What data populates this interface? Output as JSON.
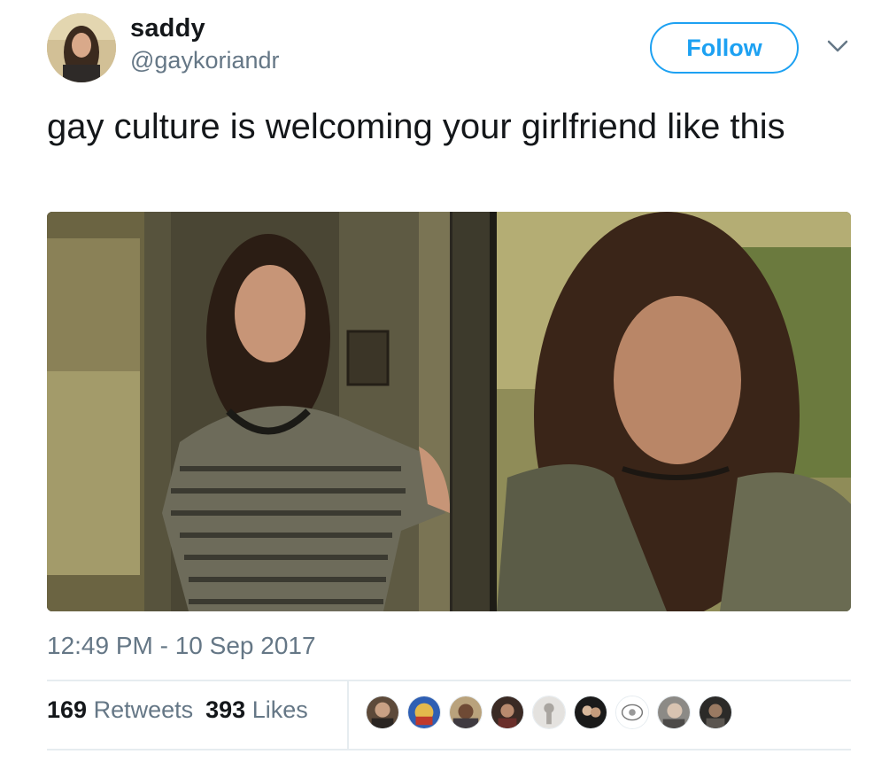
{
  "user": {
    "display_name": "saddy",
    "handle": "@gaykoriandr"
  },
  "actions": {
    "follow_label": "Follow"
  },
  "tweet": {
    "text": "gay culture is welcoming your girlfriend like this",
    "timestamp": "12:49 PM - 10 Sep 2017"
  },
  "stats": {
    "retweets_count": "169",
    "retweets_label": "Retweets",
    "likes_count": "393",
    "likes_label": "Likes"
  },
  "liker_avatars": [
    {
      "name": "liker-avatar-1"
    },
    {
      "name": "liker-avatar-2"
    },
    {
      "name": "liker-avatar-3"
    },
    {
      "name": "liker-avatar-4"
    },
    {
      "name": "liker-avatar-5"
    },
    {
      "name": "liker-avatar-6"
    },
    {
      "name": "liker-avatar-7"
    },
    {
      "name": "liker-avatar-8"
    },
    {
      "name": "liker-avatar-9"
    }
  ],
  "colors": {
    "accent": "#1da1f2",
    "secondary_text": "#657786",
    "primary_text": "#14171a",
    "divider": "#e6ecf0"
  },
  "icons": {
    "caret": "chevron-down-icon"
  }
}
